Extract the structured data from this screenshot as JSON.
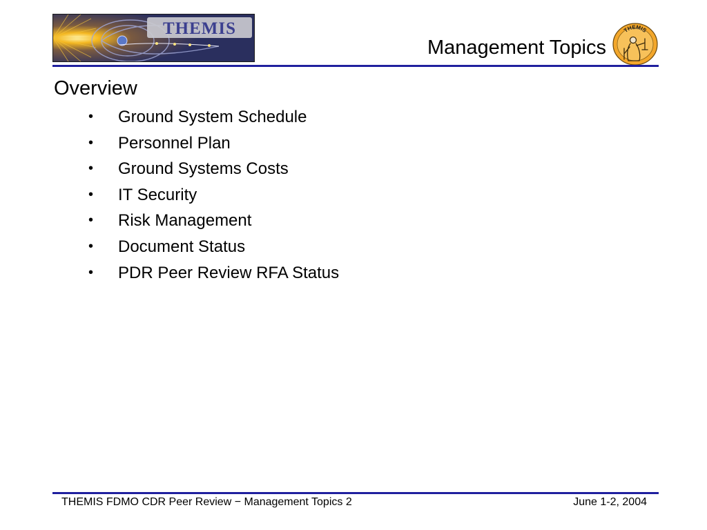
{
  "header": {
    "logo_text": "THEMIS",
    "title": "Management Topics",
    "patch_text": "THEMIS"
  },
  "content": {
    "heading": "Overview",
    "topics": [
      "Ground System Schedule",
      "Personnel Plan",
      "Ground Systems Costs",
      "IT Security",
      "Risk Management",
      "Document Status",
      "PDR Peer Review RFA Status"
    ],
    "bullet_symbol": "•"
  },
  "footer": {
    "left_text": "THEMIS FDMO CDR Peer Review − Management Topics 2",
    "right_text": "June 1-2, 2004"
  },
  "colors": {
    "rule": "#1f1f9e",
    "logo_background": "#2a2f5e",
    "logo_plate": "#c9c9cf",
    "logo_text": "#3b3f8f",
    "patch_fill": "#f3a72b"
  }
}
